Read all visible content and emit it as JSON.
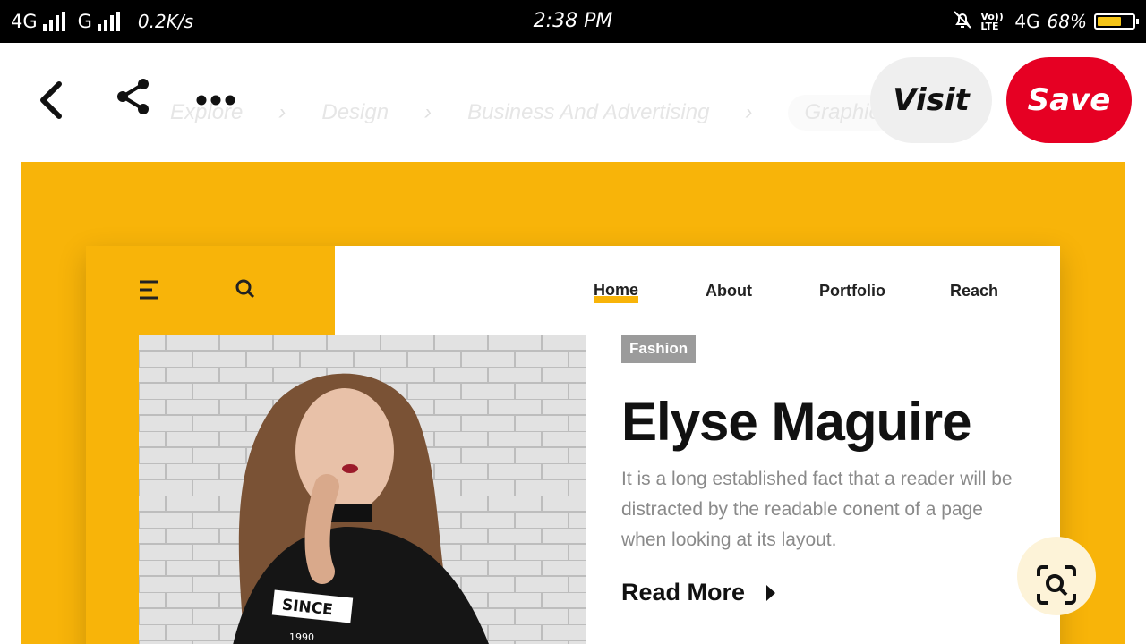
{
  "status_bar": {
    "network1": "4G",
    "network2": "G",
    "speed": "0.2K/s",
    "time": "2:38 PM",
    "volte": "Vo)) LTE",
    "network3": "4G",
    "battery": "68%",
    "battery_level": 0.68
  },
  "breadcrumb": [
    "Explore",
    "Design",
    "Business And Advertising",
    "Graphic"
  ],
  "actions": {
    "visit": "Visit",
    "save": "Save"
  },
  "pin": {
    "nav": [
      "Home",
      "About",
      "Portfolio",
      "Reach"
    ],
    "tag": "Fashion",
    "headline": "Elyse Maguire",
    "description": "It is a long established fact that a reader will be distracted by the readable conent of a page when looking at its layout.",
    "read_more": "Read More",
    "shirt_text": "SINCE",
    "shirt_year": "1990"
  },
  "colors": {
    "accent": "#f8b409",
    "save": "#e60023"
  }
}
